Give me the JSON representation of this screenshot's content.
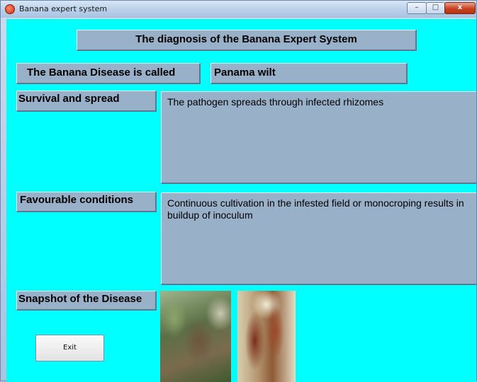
{
  "window": {
    "title": "Banana expert system",
    "minimize_glyph": "–",
    "maximize_glyph": "□",
    "close_glyph": "x",
    "app_icon": "banana-app-icon"
  },
  "header": {
    "title": "The diagnosis of the Banana Expert System"
  },
  "disease": {
    "label": "The Banana Disease is called",
    "value": "Panama wilt"
  },
  "survival": {
    "label": "Survival and spread",
    "text": "The pathogen spreads through infected rhizomes"
  },
  "favourable": {
    "label": "Favourable conditions",
    "text": "Continuous cultivation in the infested field or monocroping results in buildup of inoculum"
  },
  "snapshot": {
    "label": "Snapshot of the Disease"
  },
  "exit": {
    "label": "Exit"
  },
  "colors": {
    "background": "#00ffff",
    "panel": "#99b0c9"
  }
}
